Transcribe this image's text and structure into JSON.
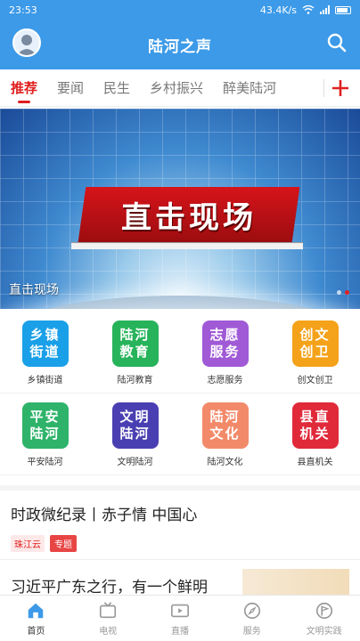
{
  "status_bar": {
    "time": "23:53",
    "net_speed": "43.4K/s"
  },
  "header": {
    "title": "陆河之声"
  },
  "tabs": [
    {
      "label": "推荐",
      "active": true
    },
    {
      "label": "要闻"
    },
    {
      "label": "民生"
    },
    {
      "label": "乡村振兴"
    },
    {
      "label": "醉美陆河"
    }
  ],
  "banner": {
    "caption": "直击现场",
    "overlay_text": "直击现场",
    "slide_current": 2,
    "slide_total": 2
  },
  "grid": [
    {
      "tile_line1": "乡镇",
      "tile_line2": "街道",
      "label": "乡镇街道",
      "color": "#1aa0e8"
    },
    {
      "tile_line1": "陆河",
      "tile_line2": "教育",
      "label": "陆河教育",
      "color": "#27b35a"
    },
    {
      "tile_line1": "志愿",
      "tile_line2": "服务",
      "label": "志愿服务",
      "color": "#a05ad6"
    },
    {
      "tile_line1": "创文",
      "tile_line2": "创卫",
      "label": "创文创卫",
      "color": "#f4a21a"
    },
    {
      "tile_line1": "平安",
      "tile_line2": "陆河",
      "label": "平安陆河",
      "color": "#2fb36a"
    },
    {
      "tile_line1": "文明",
      "tile_line2": "陆河",
      "label": "文明陆河",
      "color": "#4a3fb2"
    },
    {
      "tile_line1": "陆河",
      "tile_line2": "文化",
      "label": "陆河文化",
      "color": "#f28a6a"
    },
    {
      "tile_line1": "县直",
      "tile_line2": "机关",
      "label": "县直机关",
      "color": "#e02a3a"
    }
  ],
  "articles": [
    {
      "title": "时政微纪录丨赤子情 中国心",
      "source": "珠江云",
      "tag": "专题"
    },
    {
      "title": "习近平广东之行，有一个鲜明"
    }
  ],
  "bottom_nav": [
    {
      "label": "首页",
      "icon": "home-icon",
      "active": true
    },
    {
      "label": "电视",
      "icon": "tv-icon"
    },
    {
      "label": "直播",
      "icon": "live-icon"
    },
    {
      "label": "服务",
      "icon": "compass-icon"
    },
    {
      "label": "文明实践",
      "icon": "flag-icon"
    }
  ],
  "colors": {
    "brand_blue": "#3c9ae8",
    "accent_red": "#e02020"
  }
}
